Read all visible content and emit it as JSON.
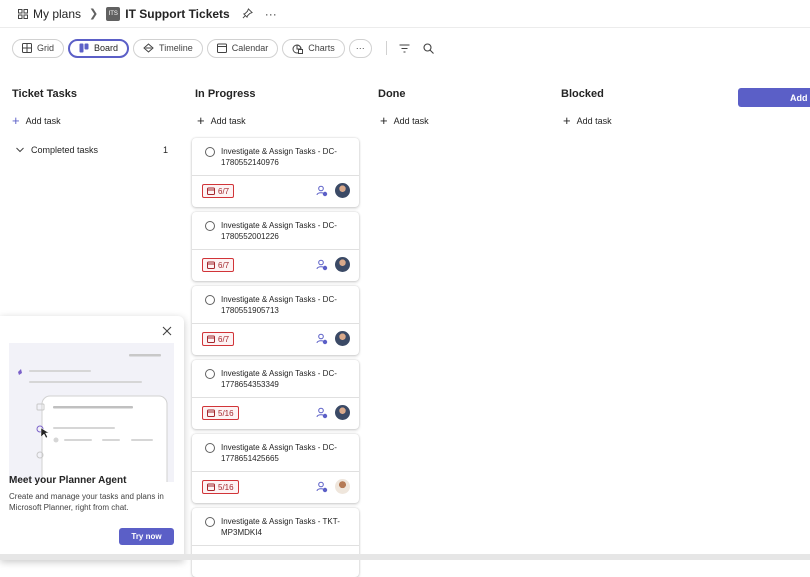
{
  "breadcrumb": {
    "root": "My plans",
    "plan_badge": "ITS",
    "plan_title": "IT Support Tickets"
  },
  "toolbar": {
    "views": [
      {
        "label": "Grid",
        "icon": "grid-icon"
      },
      {
        "label": "Board",
        "icon": "board-icon",
        "active": true
      },
      {
        "label": "Timeline",
        "icon": "timeline-icon"
      },
      {
        "label": "Calendar",
        "icon": "calendar-icon"
      },
      {
        "label": "Charts",
        "icon": "charts-icon"
      }
    ],
    "more_label": "···"
  },
  "columns": [
    {
      "title": "Ticket Tasks",
      "add_label": "Add task",
      "completed_label": "Completed tasks",
      "completed_count": "1"
    },
    {
      "title": "In Progress",
      "add_label": "Add task"
    },
    {
      "title": "Done",
      "add_label": "Add task"
    },
    {
      "title": "Blocked",
      "add_label": "Add task"
    }
  ],
  "add_bucket_label": "Add b",
  "cards": [
    {
      "title": "Investigate & Assign Tasks - DC-1780552140976",
      "date": "6/7"
    },
    {
      "title": "Investigate & Assign Tasks - DC-1780552001226",
      "date": "6/7"
    },
    {
      "title": "Investigate & Assign Tasks - DC-1780551905713",
      "date": "6/7"
    },
    {
      "title": "Investigate & Assign Tasks - DC-1778654353349",
      "date": "5/16"
    },
    {
      "title": "Investigate & Assign Tasks - DC-1778651425665",
      "date": "5/16"
    },
    {
      "title": "Investigate & Assign Tasks - TKT-MP3MDKI4"
    }
  ],
  "agent_panel": {
    "title": "Meet your Planner Agent",
    "description": "Create and manage your tasks and plans in Microsoft Planner, right from chat.",
    "cta": "Try now"
  },
  "colors": {
    "accent": "#5b5fc7",
    "overdue": "#d13438"
  }
}
